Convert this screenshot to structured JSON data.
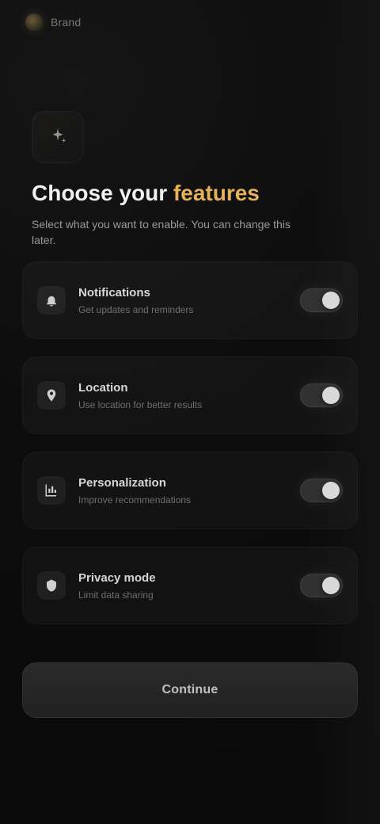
{
  "brand": {
    "name": "Brand",
    "icon": "brand-mark-icon"
  },
  "hero": {
    "icon": "sparkle-icon",
    "title_primary": "Choose your",
    "title_accent": "features",
    "subtitle": "Select what you want to enable. You can change this later."
  },
  "options": [
    {
      "icon": "bell-icon",
      "title": "Notifications",
      "desc": "Get updates and reminders",
      "toggle_state": "on"
    },
    {
      "icon": "location-icon",
      "title": "Location",
      "desc": "Use location for better results",
      "toggle_state": "on"
    },
    {
      "icon": "chart-icon",
      "title": "Personalization",
      "desc": "Improve recommendations",
      "toggle_state": "on"
    },
    {
      "icon": "shield-icon",
      "title": "Privacy mode",
      "desc": "Limit data sharing",
      "toggle_state": "on"
    }
  ],
  "cta": {
    "label": "Continue"
  }
}
